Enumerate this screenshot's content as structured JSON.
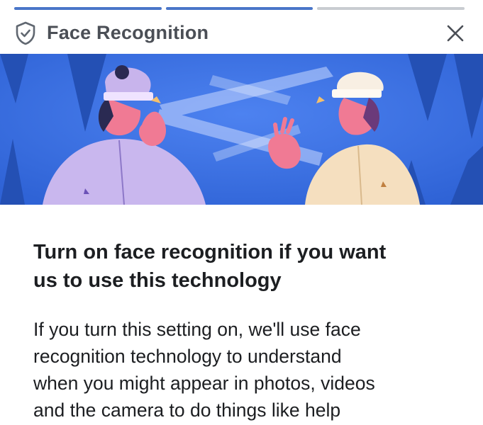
{
  "progress": {
    "segments": [
      {
        "state": "complete",
        "color": "#4a76c9"
      },
      {
        "state": "complete",
        "color": "#4a76c9"
      },
      {
        "state": "pending",
        "color": "#c9ccd1"
      }
    ]
  },
  "header": {
    "title": "Face Recognition",
    "icons": {
      "leading": "shield-check-icon",
      "trailing": "close-icon"
    }
  },
  "illustration": {
    "name": "two-people-face-scan-illustration",
    "background_color": "#3b6fe0"
  },
  "content": {
    "headline_line1": "Turn on face recognition if you want",
    "headline_line2": "us to use this technology",
    "body_line1": "If you turn this setting on, we'll use face",
    "body_line2": "recognition technology to understand",
    "body_line3": "when you might appear in photos, videos",
    "body_line4": "and the camera to do things like help"
  }
}
